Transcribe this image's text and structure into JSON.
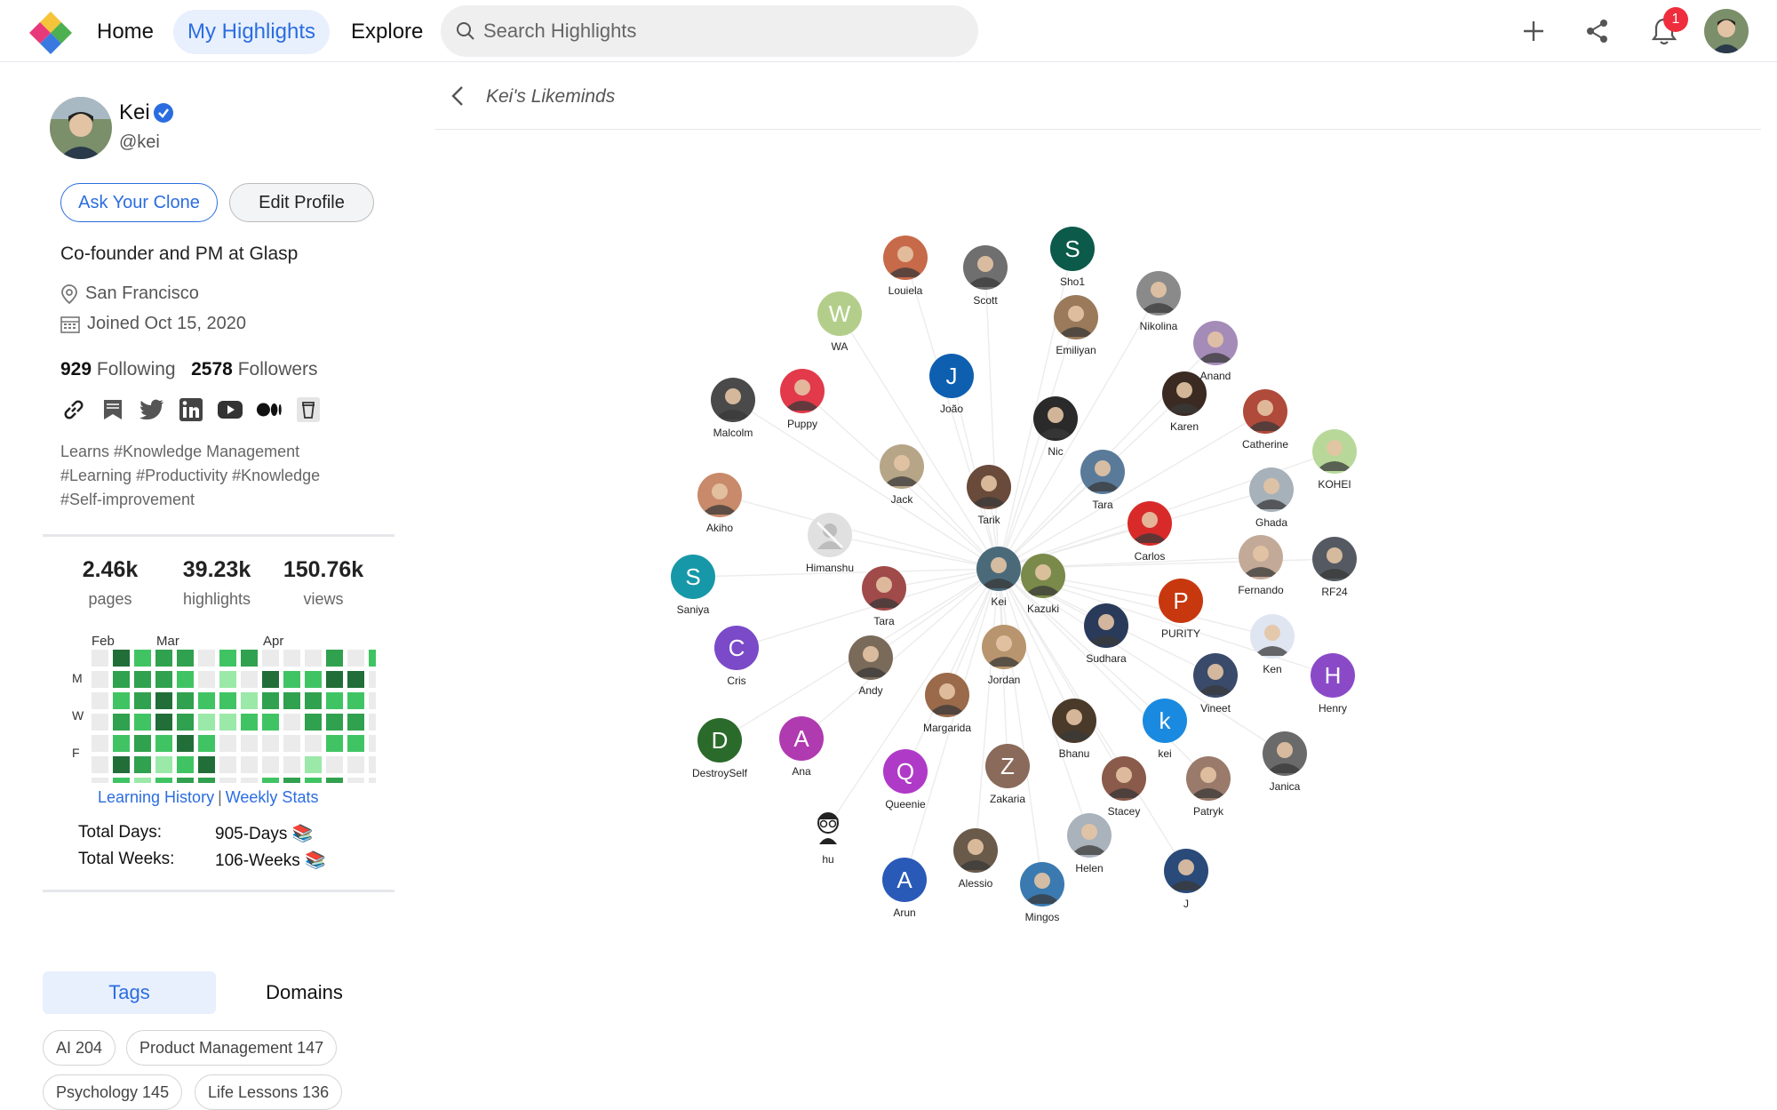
{
  "topbar": {
    "nav": [
      "Home",
      "My Highlights",
      "Explore"
    ],
    "search_placeholder": "Search Highlights",
    "notification_count": "1",
    "icons": [
      "plus-icon",
      "share-icon",
      "bell-icon"
    ]
  },
  "profile": {
    "name": "Kei",
    "handle": "@kei",
    "ask_clone_label": "Ask Your Clone",
    "edit_profile_label": "Edit Profile",
    "bio": "Co-founder and PM at Glasp",
    "location": "San Francisco",
    "joined": "Joined Oct 15, 2020",
    "following_count": "929",
    "following_label": "Following",
    "followers_count": "2578",
    "followers_label": "Followers",
    "social_icons": [
      "link-icon",
      "bookmark-icon",
      "twitter-icon",
      "linkedin-icon",
      "youtube-icon",
      "medium-icon",
      "cup-icon"
    ],
    "hashtags": "Learns #Knowledge Management #Learning #Productivity #Knowledge #Self-improvement"
  },
  "stats": [
    {
      "value": "2.46k",
      "label": "pages"
    },
    {
      "value": "39.23k",
      "label": "highlights"
    },
    {
      "value": "150.76k",
      "label": "views"
    }
  ],
  "activity": {
    "months": [
      "Feb",
      "Mar",
      "Apr"
    ],
    "days": [
      "M",
      "W",
      "F"
    ],
    "colors": [
      "#ebebeb",
      "#9be9a8",
      "#40c463",
      "#30a14e",
      "#216e39"
    ],
    "levels": [
      [
        0,
        0,
        0,
        0,
        0,
        0,
        0
      ],
      [
        4,
        3,
        2,
        3,
        2,
        4,
        2
      ],
      [
        2,
        3,
        3,
        2,
        3,
        3,
        1
      ],
      [
        3,
        3,
        4,
        4,
        2,
        1,
        2
      ],
      [
        3,
        2,
        3,
        3,
        4,
        2,
        3
      ],
      [
        0,
        0,
        2,
        1,
        2,
        4,
        3
      ],
      [
        2,
        1,
        2,
        1,
        0,
        0,
        0
      ],
      [
        3,
        0,
        1,
        2,
        0,
        0,
        0
      ],
      [
        0,
        4,
        3,
        2,
        0,
        0,
        2
      ],
      [
        0,
        2,
        3,
        0,
        0,
        0,
        3
      ],
      [
        0,
        2,
        3,
        3,
        0,
        1,
        2
      ],
      [
        3,
        4,
        2,
        3,
        2,
        0,
        3
      ],
      [
        0,
        4,
        2,
        3,
        2,
        0,
        0
      ],
      [
        2,
        0,
        0,
        0,
        0,
        0,
        0
      ]
    ],
    "links": [
      "Learning History",
      "Weekly Stats"
    ],
    "total_days_label": "Total Days:",
    "total_days_value": "905-Days 📚",
    "total_weeks_label": "Total Weeks:",
    "total_weeks_value": "106-Weeks 📚"
  },
  "tabs": {
    "tags": "Tags",
    "domains": "Domains"
  },
  "tags": [
    "AI 204",
    "Product Management 147",
    "Psychology 145",
    "Life Lessons 136"
  ],
  "main": {
    "title": "Kei's Likeminds"
  },
  "graph": {
    "center": "Kei",
    "nodes": [
      {
        "label": "Louiela",
        "kind": "photo",
        "color": "#c76a4a"
      },
      {
        "label": "Scott",
        "kind": "photo",
        "color": "#6f6f6f"
      },
      {
        "label": "Sho1",
        "kind": "letter",
        "letter": "S",
        "color": "#0b5a4a"
      },
      {
        "label": "Nikolina",
        "kind": "photo",
        "color": "#8a8a8a"
      },
      {
        "label": "WA",
        "kind": "letter",
        "letter": "W",
        "color": "#b3ce8a"
      },
      {
        "label": "Emiliyan",
        "kind": "photo",
        "color": "#9a7a5a"
      },
      {
        "label": "Anand",
        "kind": "photo",
        "color": "#a58cb8"
      },
      {
        "label": "João",
        "kind": "letter",
        "letter": "J",
        "color": "#0e5fb0"
      },
      {
        "label": "Malcolm",
        "kind": "photo",
        "color": "#4a4a4a"
      },
      {
        "label": "Puppy",
        "kind": "photo",
        "color": "#e23a4a"
      },
      {
        "label": "Karen",
        "kind": "photo",
        "color": "#3a2a22"
      },
      {
        "label": "Catherine",
        "kind": "photo",
        "color": "#b04a3a"
      },
      {
        "label": "Nic",
        "kind": "photo",
        "color": "#2a2a2a"
      },
      {
        "label": "KOHEI",
        "kind": "photo",
        "color": "#b8d89a"
      },
      {
        "label": "Jack",
        "kind": "photo",
        "color": "#b6a587"
      },
      {
        "label": "Tara",
        "kind": "photo",
        "color": "#5a7a9a"
      },
      {
        "label": "Akiho",
        "kind": "photo",
        "color": "#c88a6a"
      },
      {
        "label": "Tarik",
        "kind": "photo",
        "color": "#6a4a3a"
      },
      {
        "label": "Ghada",
        "kind": "photo",
        "color": "#a7b1ba"
      },
      {
        "label": "Carlos",
        "kind": "photo",
        "color": "#d92a2a"
      },
      {
        "label": "Himanshu",
        "kind": "placeholder",
        "color": "#e0e0e0"
      },
      {
        "label": "Fernando",
        "kind": "photo",
        "color": "#c3aa98"
      },
      {
        "label": "RF24",
        "kind": "photo",
        "color": "#555a62"
      },
      {
        "label": "Saniya",
        "kind": "letter",
        "letter": "S",
        "color": "#1798a8"
      },
      {
        "label": "Kei",
        "kind": "photo",
        "color": "#4a6a7a"
      },
      {
        "label": "Kazuki",
        "kind": "photo",
        "color": "#7a8a4a"
      },
      {
        "label": "Tara",
        "kind": "photo",
        "color": "#a04a4a"
      },
      {
        "label": "PURITY",
        "kind": "letter",
        "letter": "P",
        "color": "#c8380f"
      },
      {
        "label": "Sudhara",
        "kind": "photo",
        "color": "#2a3a5a"
      },
      {
        "label": "Ken",
        "kind": "photo",
        "color": "#dfe6f2"
      },
      {
        "label": "Cris",
        "kind": "letter",
        "letter": "C",
        "color": "#7a4ac8"
      },
      {
        "label": "Jordan",
        "kind": "photo",
        "color": "#b8956e"
      },
      {
        "label": "Andy",
        "kind": "photo",
        "color": "#7a6a5a"
      },
      {
        "label": "Henry",
        "kind": "letter",
        "letter": "H",
        "color": "#8a4ac8"
      },
      {
        "label": "Vineet",
        "kind": "photo",
        "color": "#3a4a6a"
      },
      {
        "label": "Margarida",
        "kind": "photo",
        "color": "#9a6a4a"
      },
      {
        "label": "kei",
        "kind": "letter",
        "letter": "k",
        "color": "#1a8ae0"
      },
      {
        "label": "DestroySelf",
        "kind": "letter",
        "letter": "D",
        "color": "#2a6a2a"
      },
      {
        "label": "Ana",
        "kind": "letter",
        "letter": "A",
        "color": "#b03ab0"
      },
      {
        "label": "Bhanu",
        "kind": "photo",
        "color": "#4a3a2a"
      },
      {
        "label": "Janica",
        "kind": "photo",
        "color": "#6a6a6a"
      },
      {
        "label": "Zakaria",
        "kind": "letter",
        "letter": "Z",
        "color": "#8a6a5a"
      },
      {
        "label": "Queenie",
        "kind": "letter",
        "letter": "Q",
        "color": "#b03ac8"
      },
      {
        "label": "Stacey",
        "kind": "photo",
        "color": "#8a5a4a"
      },
      {
        "label": "Patryk",
        "kind": "photo",
        "color": "#9a7a6a"
      },
      {
        "label": "hu",
        "kind": "sketch",
        "color": "#ffffff"
      },
      {
        "label": "Helen",
        "kind": "photo",
        "color": "#aab2bc"
      },
      {
        "label": "Alessio",
        "kind": "photo",
        "color": "#6a5a4a"
      },
      {
        "label": "J",
        "kind": "photo",
        "color": "#2a4a7a"
      },
      {
        "label": "Arun",
        "kind": "letter",
        "letter": "A",
        "color": "#2a5ab8"
      },
      {
        "label": "Mingos",
        "kind": "photo",
        "color": "#3a7ab0"
      }
    ]
  }
}
